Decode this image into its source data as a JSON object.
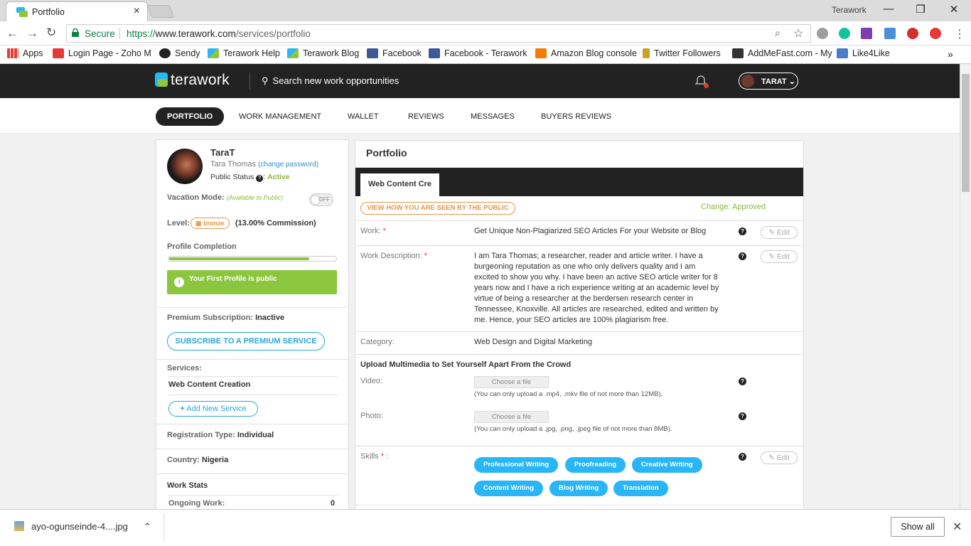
{
  "browser": {
    "tab_title": "Portfolio",
    "window_title": "Terawork",
    "secure_label": "Secure",
    "url_proto": "https://",
    "url_host": "www.terawork.com",
    "url_path": "/services/portfolio",
    "bookmarks": [
      "Apps",
      "Login Page - Zoho M",
      "Sendy",
      "Terawork Help",
      "Terawork Blog",
      "Facebook",
      "Facebook - Terawork",
      "Amazon Blog console",
      "Twitter Followers",
      "AddMeFast.com - My",
      "Like4Like"
    ],
    "bookmark_overflow": "»"
  },
  "header": {
    "logo": "terawork",
    "search_placeholder": "Search new work opportunities",
    "user_name": "TARAT"
  },
  "menu": [
    "PORTFOLIO",
    "WORK MANAGEMENT",
    "WALLET",
    "REVIEWS",
    "MESSAGES",
    "BUYERS REVIEWS"
  ],
  "profile": {
    "username": "TaraT",
    "fullname": "Tara Thomas",
    "change_password": "(change password)",
    "public_status_label": "Public Status",
    "public_status_value": "Active",
    "vacation_label": "Vacation Mode:",
    "vacation_note": "(Available to Public)",
    "toggle_text": "OFF",
    "level_label": "Level:",
    "level_badge": "bronze",
    "commission": "(13.00% Commission)",
    "completion_label": "Profile Completion",
    "completion_fraction": 0.84,
    "public_msg": "Your First Profile is public",
    "premium_label": "Premium Subscription:",
    "premium_value": "Inactive",
    "subscribe_btn": "SUBSCRIBE TO A PREMIUM SERVICE",
    "services_label": "Services:",
    "service_item": "Web Content Creation",
    "add_service": "Add New Service",
    "reg_label": "Registration Type:",
    "reg_value": "Individual",
    "country_label": "Country:",
    "country_value": "Nigeria",
    "work_stats": "Work Stats",
    "ongoing_label": "Ongoing Work:",
    "ongoing_value": "0"
  },
  "portfolio": {
    "title": "Portfolio",
    "sub_tab": "Web Content Cre",
    "view_btn": "VIEW HOW YOU ARE SEEN BY THE PUBLIC",
    "change_status": "Change: Approved",
    "work_label": "Work:",
    "work_value": "Get Unique Non-Plagiarized SEO Articles For your Website or Blog",
    "desc_label": "Work Description:",
    "desc_lines": [
      "I am Tara Thomas; a researcher, reader and article writer. I have a",
      "burgeoning reputation as one who only delivers quality and I am",
      "excited to show you why. I have been an active SEO article writer for 8",
      "years now and I have a rich experience writing at an academic level by",
      "virtue of being a researcher at the berdersen research center in",
      "Tennessee, Knoxville. All articles are researched, edited and written by",
      "me. Hence, your SEO articles are 100% plagiarism free."
    ],
    "category_label": "Category:",
    "category_value": "Web Design and Digital Marketing",
    "upload_heading": "Upload Multimedia to Set Yourself Apart From the Crowd",
    "video_label": "Video:",
    "photo_label": "Photo:",
    "choose_file": "Choose a file",
    "video_hint": "(You can only upload a .mp4, .mkv file of not more than 12MB).",
    "photo_hint": "(You can only upload a .jpg, .png, .jpeg file of not more than 8MB).",
    "skills_label": "Skills",
    "skills": [
      "Professional Writing",
      "Proofreading",
      "Creative Writing",
      "Content Writing",
      "Blog Writing",
      "Translation"
    ],
    "edit_label": "Edit",
    "q": "?"
  },
  "downloads": {
    "file": "ayo-ogunseinde-4....jpg",
    "show_all": "Show all"
  },
  "colors": {
    "accent": "#29b6f6",
    "green": "#8cc63f",
    "bronze": "#e8954a",
    "header": "#222222"
  }
}
